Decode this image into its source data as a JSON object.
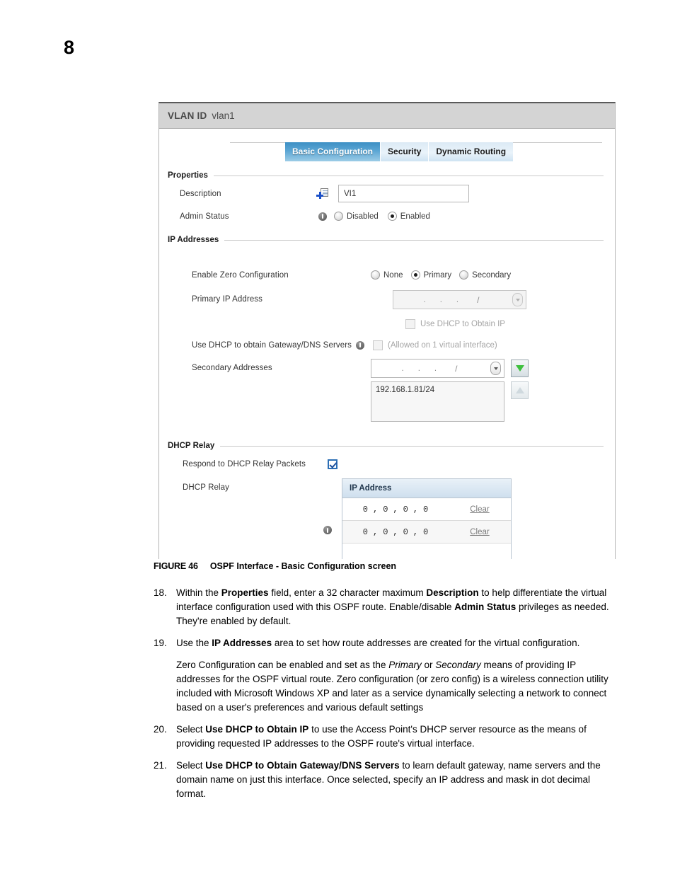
{
  "page": {
    "number": "8"
  },
  "figure": {
    "caption_number": "FIGURE 46",
    "caption_text": "OSPF Interface - Basic Configuration screen",
    "panel_header": {
      "title": "VLAN ID",
      "value": "vlan1"
    },
    "tabs": [
      {
        "label": "Basic Configuration",
        "active": true
      },
      {
        "label": "Security",
        "active": false
      },
      {
        "label": "Dynamic Routing",
        "active": false
      }
    ],
    "properties": {
      "section_label": "Properties",
      "description_label": "Description",
      "description_value": "VI1",
      "admin_status_label": "Admin Status",
      "admin_status_options": [
        "Disabled",
        "Enabled"
      ],
      "admin_status_selected": "Enabled"
    },
    "ip_addresses": {
      "section_label": "IP Addresses",
      "zero_config_label": "Enable Zero Configuration",
      "zero_config_options": [
        "None",
        "Primary",
        "Secondary"
      ],
      "zero_config_selected": "Primary",
      "primary_ip_label": "Primary IP Address",
      "primary_ip_value": "",
      "ip_octet_dot": ".",
      "ip_slash": "/",
      "use_dhcp_obtain_ip_label": "Use DHCP to Obtain IP",
      "use_dhcp_gateway_label": "Use DHCP to obtain Gateway/DNS Servers",
      "use_dhcp_gateway_note": "(Allowed on 1 virtual interface)",
      "secondary_label": "Secondary Addresses",
      "secondary_entry_value": "",
      "secondary_list": [
        "192.168.1.81/24"
      ]
    },
    "dhcp_relay": {
      "section_label": "DHCP Relay",
      "respond_label": "Respond to DHCP Relay Packets",
      "respond_checked": true,
      "relay_label": "DHCP Relay",
      "table_header": "IP Address",
      "rows": [
        {
          "octets": [
            "0",
            "0",
            "0",
            "0"
          ],
          "action": "Clear"
        },
        {
          "octets": [
            "0",
            "0",
            "0",
            "0"
          ],
          "action": "Clear"
        }
      ]
    },
    "colors": {
      "tab_active_start": "#3d8fc4",
      "tab_active_end": "#9ccce6",
      "tab_inactive": "#dceaf5",
      "header_bar": "#d4d4d4",
      "edit_icon_blue": "#1b50c8",
      "green_arrow": "#3ec03e",
      "table_header": "#cfdfee"
    }
  },
  "steps": [
    {
      "number": "18.",
      "html": "Within the <b>Properties</b> field, enter a 32 character maximum <b>Description</b> to help differentiate the virtual interface configuration used with this OSPF route. Enable/disable <b>Admin Status</b> privileges as needed. They're enabled by default."
    },
    {
      "number": "19.",
      "html": "Use the <b>IP Addresses</b> area to set how route addresses are created for the virtual configuration."
    },
    {
      "number": "",
      "html": "Zero Configuration can be enabled and set as the <i>Primary</i> or <i>Secondary</i> means of providing IP addresses for the OSPF virtual route. Zero configuration (or zero config) is a wireless connection utility included with Microsoft Windows XP and later as a service dynamically selecting a network to connect based on a user's preferences and various default settings"
    },
    {
      "number": "20.",
      "html": "Select <b>Use DHCP to Obtain IP</b> to use the Access Point's DHCP server resource as the means of providing requested IP addresses to the OSPF route's virtual interface."
    },
    {
      "number": "21.",
      "html": "Select <b>Use DHCP to Obtain Gateway/DNS Servers</b> to learn default gateway, name servers and the domain name on just this interface. Once selected, specify an IP address and mask in dot decimal format."
    }
  ]
}
